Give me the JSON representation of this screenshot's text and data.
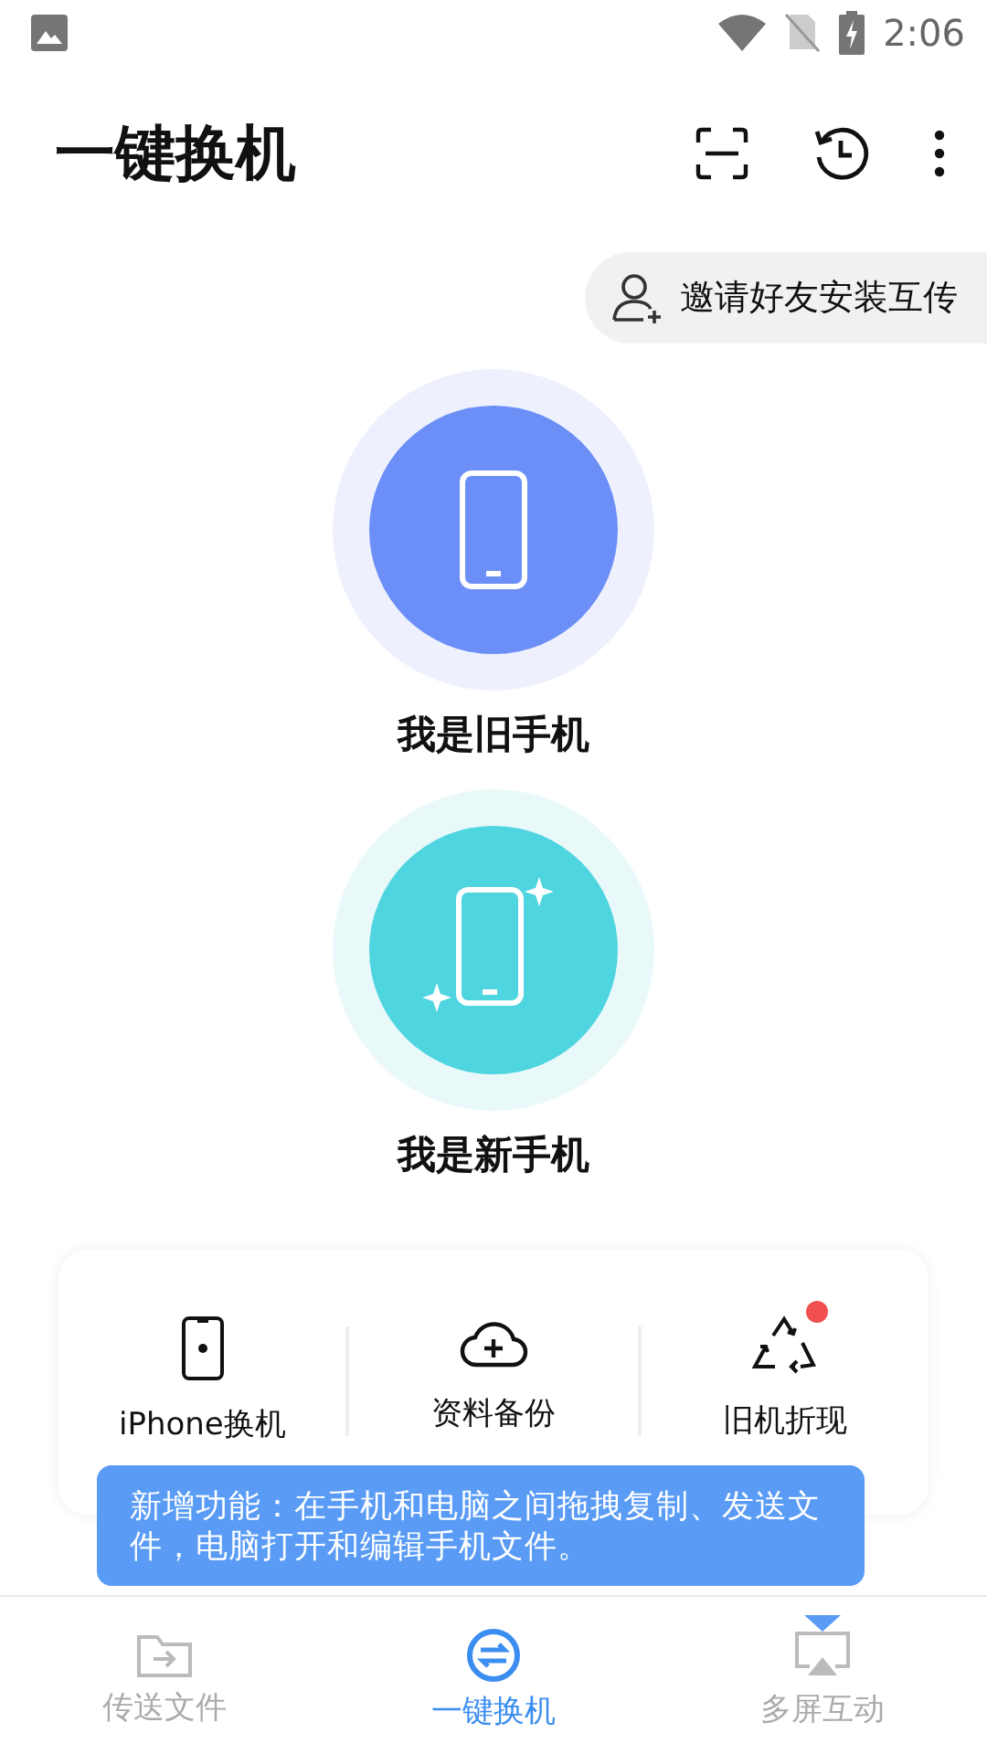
{
  "status_bar": {
    "time": "2:06"
  },
  "app_bar": {
    "title": "一键换机"
  },
  "invite": {
    "label": "邀请好友安装互传"
  },
  "roles": [
    {
      "kind": "old",
      "label": "我是旧手机"
    },
    {
      "kind": "new",
      "label": "我是新手机"
    }
  ],
  "features": [
    {
      "kind": "iphone",
      "label": "iPhone换机",
      "badge": false
    },
    {
      "kind": "backup",
      "label": "资料备份",
      "badge": false
    },
    {
      "kind": "recycle",
      "label": "旧机折现",
      "badge": true
    }
  ],
  "tooltip": {
    "text": "新增功能：在手机和电脑之间拖拽复制、发送文件，电脑打开和编辑手机文件。"
  },
  "nav": [
    {
      "kind": "files",
      "label": "传送文件",
      "selected": false
    },
    {
      "kind": "switch",
      "label": "一键换机",
      "selected": true
    },
    {
      "kind": "screen",
      "label": "多屏互动",
      "selected": false
    }
  ]
}
